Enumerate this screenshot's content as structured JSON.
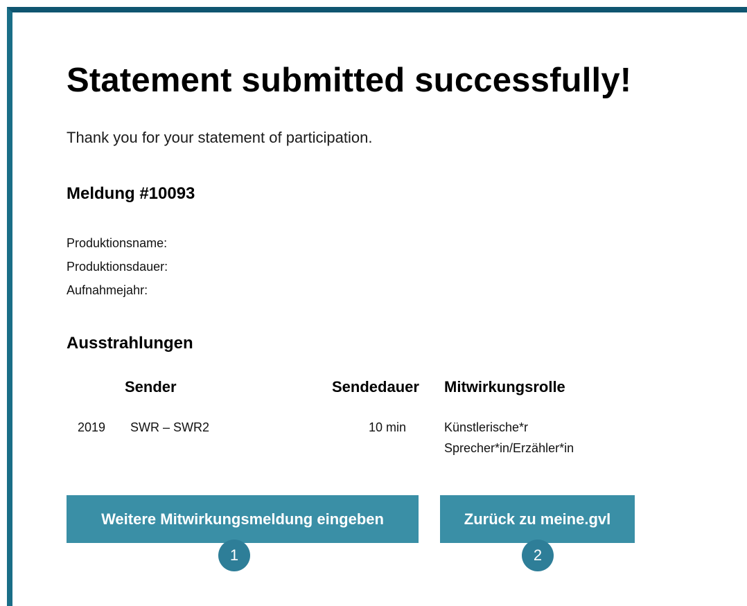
{
  "page": {
    "title": "Statement submitted successfully!",
    "intro": "Thank you for your statement of participation."
  },
  "meldung": {
    "heading": "Meldung #10093",
    "fields": [
      {
        "label": "Produktionsname:"
      },
      {
        "label": "Produktionsdauer:"
      },
      {
        "label": "Aufnahmejahr:"
      }
    ]
  },
  "ausstrahlungen": {
    "heading": "Ausstrahlungen",
    "columns": {
      "sender": "Sender",
      "dauer": "Sendedauer",
      "rolle": "Mitwirkungsrolle"
    },
    "rows": [
      {
        "year": "2019",
        "sender": "SWR – SWR2",
        "dauer": "10 min",
        "rolle": "Künstlerische*r Sprecher*in/Erzähler*in"
      }
    ]
  },
  "actions": {
    "primary_label": "Weitere Mitwirkungsmeldung eingeben",
    "secondary_label": "Zurück zu meine.gvl",
    "badge_1": "1",
    "badge_2": "2"
  },
  "colors": {
    "frame_top": "#0f5570",
    "frame_left": "#1a6e87",
    "button": "#3a8fa6",
    "badge": "#2e7e98"
  }
}
